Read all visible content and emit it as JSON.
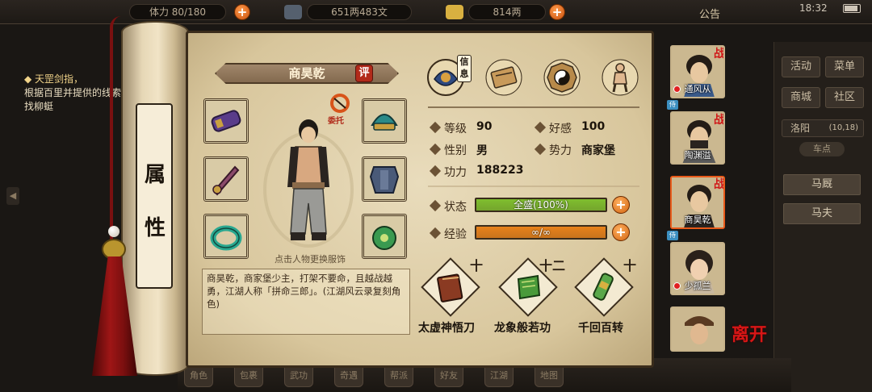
{
  "topbar": {
    "stamina": "体力 80/180",
    "copper": "651两483文",
    "silver": "814两",
    "notice": "公告",
    "clock": "18:32"
  },
  "quest": {
    "title": "◆ 天罡剑指，",
    "body": "根据百里并提供的线索寻找柳蜓"
  },
  "right_panel": {
    "buttons": [
      "活动",
      "菜单",
      "商城",
      "社区"
    ],
    "location": "洛阳",
    "coord": "(10,18)",
    "tab": "车点",
    "list": [
      "马厩",
      "马夫"
    ]
  },
  "bottom_bar": [
    "角色",
    "包裹",
    "武功",
    "奇遇",
    "帮派",
    "好友",
    "江湖",
    "地图"
  ],
  "scroll": {
    "title": "属性"
  },
  "character": {
    "name": "商昊乾",
    "eval_badge": "评",
    "entrust_label": "委托",
    "portrait_hint": "点击人物更换服饰",
    "description": "商昊乾，商家堡少主，打架不要命，且越战越勇，江湖人称「拼命三郎」。(江湖风云录复刻角色)"
  },
  "tabs": {
    "info_label": "信息"
  },
  "stats": {
    "level_label": "等级",
    "level": "90",
    "favor_label": "好感",
    "favor": "100",
    "gender_label": "性别",
    "gender": "男",
    "faction_label": "势力",
    "faction": "商家堡",
    "power_label": "功力",
    "power": "188223"
  },
  "status": {
    "label": "状态",
    "text": "全盛(100%)",
    "fill": 1.0,
    "color": "#7fbf2e"
  },
  "exp": {
    "label": "经验",
    "text": "∞/∞",
    "fill": 1.0,
    "color": "#e8821a"
  },
  "skills": [
    {
      "name": "太虚神悟刀",
      "level": "十"
    },
    {
      "name": "龙象般若功",
      "level": "十二"
    },
    {
      "name": "千回百转",
      "level": "十"
    }
  ],
  "team": [
    {
      "name": "通风从",
      "war": "战"
    },
    {
      "name": "陶渊溢",
      "war": "战"
    },
    {
      "name": "商昊乾",
      "war": "战"
    },
    {
      "name": "少孤兰",
      "war": ""
    },
    {
      "name": "",
      "war": ""
    }
  ],
  "leave_label": "离开",
  "colors": {
    "accent": "#e85a1a",
    "paper": "#e2d3b0",
    "ink": "#3a2a1a"
  }
}
